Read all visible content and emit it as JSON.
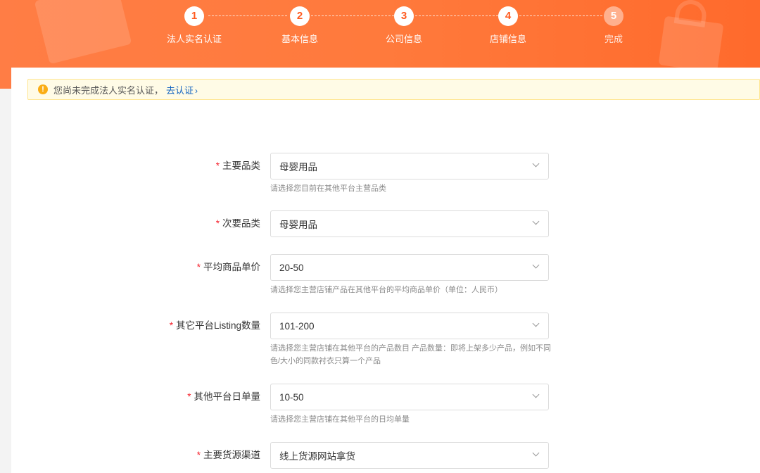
{
  "steps": [
    {
      "number": "1",
      "label": "法人实名认证",
      "state": "active"
    },
    {
      "number": "2",
      "label": "基本信息",
      "state": "active"
    },
    {
      "number": "3",
      "label": "公司信息",
      "state": "active"
    },
    {
      "number": "4",
      "label": "店铺信息",
      "state": "active"
    },
    {
      "number": "5",
      "label": "完成",
      "state": "inactive"
    }
  ],
  "notice": {
    "icon": "warning-icon",
    "text": "您尚未完成法人实名认证，",
    "link_label": "去认证"
  },
  "form": {
    "fields": [
      {
        "label": "主要品类",
        "required": true,
        "value": "母婴用品",
        "hint": "请选择您目前在其他平台主营品类"
      },
      {
        "label": "次要品类",
        "required": true,
        "value": "母婴用品",
        "hint": ""
      },
      {
        "label": "平均商品单价",
        "required": true,
        "value": "20-50",
        "hint": "请选择您主营店铺产品在其他平台的平均商品单价（单位：人民币）"
      },
      {
        "label": "其它平台Listing数量",
        "required": true,
        "value": "101-200",
        "hint": "请选择您主营店铺在其他平台的产品数目 产品数量：即将上架多少产品，例如不同色/大小的同款衬衣只算一个产品"
      },
      {
        "label": "其他平台日单量",
        "required": true,
        "value": "10-50",
        "hint": "请选择您主营店铺在其他平台的日均单量"
      },
      {
        "label": "主要货源渠道",
        "required": true,
        "value": "线上货源网站拿货",
        "hint": ""
      }
    ]
  },
  "colors": {
    "banner": "#ff7a3c",
    "required_star": "#f5222d",
    "link": "#1565c0",
    "notice_bg": "#fffbe6"
  }
}
